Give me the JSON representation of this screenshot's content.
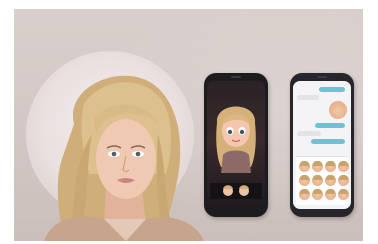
{
  "image": {
    "colors": {
      "background": "#d4c9c6",
      "halo": "#efe7e6",
      "phone_body": "#1c1c1f",
      "chat_accent": "#67c6d4"
    }
  }
}
